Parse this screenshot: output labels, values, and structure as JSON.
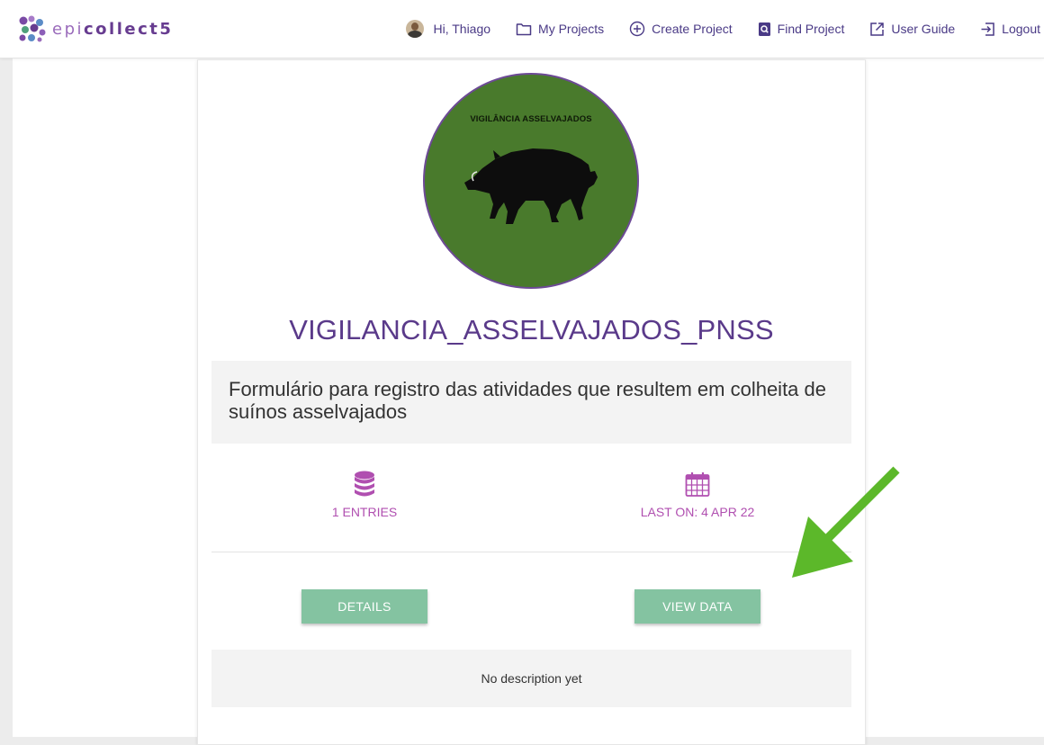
{
  "navbar": {
    "brand": {
      "epi": "epi",
      "collect": "collect5"
    },
    "user_greeting": "Hi, Thiago",
    "links": {
      "my_projects": "My Projects",
      "create_project": "Create Project",
      "find_project": "Find Project",
      "user_guide": "User Guide",
      "logout": "Logout"
    },
    "icons": {
      "my_projects": "folder-icon",
      "create_project": "plus-circle-icon",
      "find_project": "search-document-icon",
      "user_guide": "external-link-icon",
      "logout": "logout-icon"
    }
  },
  "project": {
    "logo_text": "VIGILÂNCIA ASSELVAJADOS",
    "title": "VIGILANCIA_ASSELVAJADOS_PNSS",
    "form_description": "Formulário para registro das atividades que resultem em colheita de suínos asselvajados",
    "stats": {
      "entries": "1 ENTRIES",
      "last_on": "LAST ON: 4 APR 22"
    },
    "buttons": {
      "details": "DETAILS",
      "view_data": "VIEW DATA"
    },
    "description": "No description yet"
  },
  "colors": {
    "brand_purple": "#673c90",
    "title_purple": "#5a3a8a",
    "stat_magenta": "#b04fb0",
    "button_green": "#84c3a1",
    "logo_green": "#497a2c",
    "annotation_arrow": "#5cb82a"
  }
}
